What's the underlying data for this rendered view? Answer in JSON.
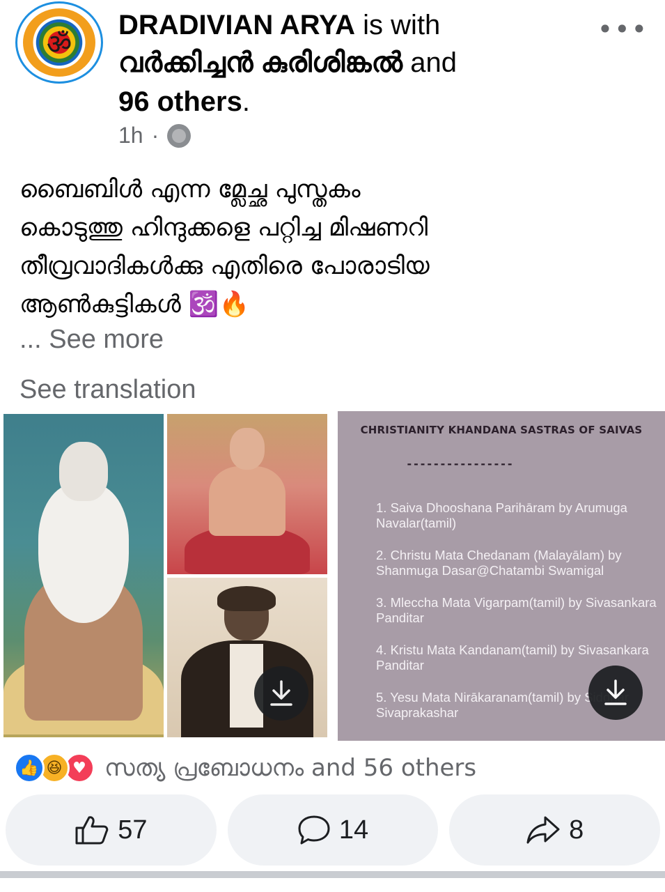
{
  "post": {
    "author": "DRADIVIAN ARYA",
    "with_label": "is with",
    "tagged_person": "വർക്കിച്ചൻ കുരിശിങ്കൽ",
    "and_label": "and",
    "others_label": "96 others",
    "period": ".",
    "time": "1h",
    "separator": "·",
    "text_lines": [
      "ബൈബിൾ എന്ന മ്ലേച്ഛ പുസ്തകം",
      "കൊടുത്തു ഹിന്ദുക്കളെ പറ്റിച്ച മിഷണറി",
      "തീവ്രവാദികൾക്കു എതിരെ പോരാടിയ",
      "ആൺകുട്ടികൾ 🕉️🔥"
    ],
    "see_more": "... See more",
    "see_translation": "See translation"
  },
  "image_card": {
    "title": "CHRISTIANITY KHANDANA SASTRAS OF SAIVAS",
    "divider": "----------------",
    "items": [
      "1. Saiva Dhooshana Parihāram by Arumuga Navalar(tamil)",
      "2. Christu Mata Chedanam (Malayālam) by Shanmuga Dasar@Chatambi Swamigal",
      "3. Mleccha Mata Vigarpam(tamil) by Sivasankara Panditar",
      "4. Kristu Mata Kandanam(tamil) by Sivasankara Panditar",
      "5. Yesu Mata Nirākaranam(tamil) by Siddhar Sivaprakashar"
    ]
  },
  "reactions": {
    "summary": "സത്യ പ്രബോധനം and 56 others",
    "like_icon": "👍",
    "haha_icon": "😆",
    "love_icon": "♥"
  },
  "actions": {
    "like_count": "57",
    "comment_count": "14",
    "share_count": "8"
  },
  "icons": {
    "avatar": "om-symbol-icon",
    "menu": "more-dots-icon",
    "audience": "globe-icon",
    "download": "download-icon"
  },
  "colors": {
    "accent": "#1877f2",
    "secondary_text": "#65676b",
    "button_bg": "#f0f2f5",
    "card_bg": "#a89ca7"
  }
}
